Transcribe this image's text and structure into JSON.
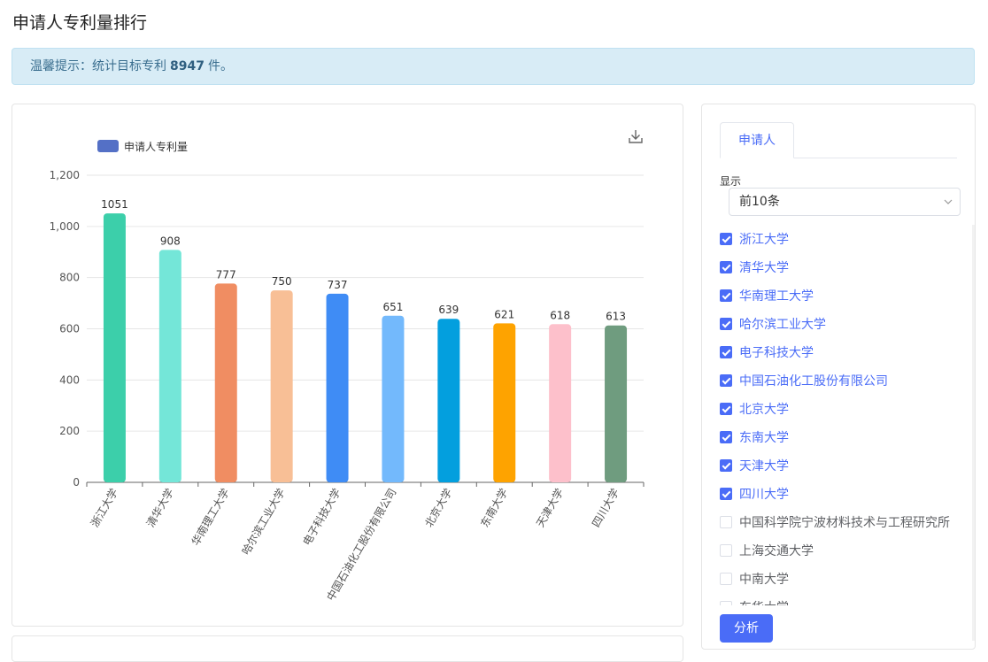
{
  "page_title": "申请人专利量排行",
  "alert": {
    "prefix": "温馨提示：统计目标专利",
    "count": "8947",
    "suffix": "件。"
  },
  "colors": [
    "#3ccfaa",
    "#74e6d8",
    "#f08d62",
    "#f8bf96",
    "#3f8cf5",
    "#73b9fc",
    "#039fde",
    "#fea300",
    "#fdc0cb",
    "#6f9c7f"
  ],
  "chart_data": {
    "type": "bar",
    "legend": "申请人专利量",
    "legend_position": "top-left",
    "categories": [
      "浙江大学",
      "清华大学",
      "华南理工大学",
      "哈尔滨工业大学",
      "电子科技大学",
      "中国石油化工股份有限公司",
      "北京大学",
      "东南大学",
      "天津大学",
      "四川大学"
    ],
    "values": [
      1051,
      908,
      777,
      750,
      737,
      651,
      639,
      621,
      618,
      613
    ],
    "yticks": [
      "0",
      "200",
      "400",
      "600",
      "800",
      "1,000",
      "1,200"
    ],
    "ylim": [
      0,
      1200
    ],
    "grid": true
  },
  "sidebar": {
    "tab": "申请人",
    "show_label": "显示",
    "select_value": "前10条",
    "items": [
      {
        "label": "浙江大学",
        "checked": true
      },
      {
        "label": "清华大学",
        "checked": true
      },
      {
        "label": "华南理工大学",
        "checked": true
      },
      {
        "label": "哈尔滨工业大学",
        "checked": true
      },
      {
        "label": "电子科技大学",
        "checked": true
      },
      {
        "label": "中国石油化工股份有限公司",
        "checked": true
      },
      {
        "label": "北京大学",
        "checked": true
      },
      {
        "label": "东南大学",
        "checked": true
      },
      {
        "label": "天津大学",
        "checked": true
      },
      {
        "label": "四川大学",
        "checked": true
      },
      {
        "label": "中国科学院宁波材料技术与工程研究所",
        "checked": false
      },
      {
        "label": "上海交通大学",
        "checked": false
      },
      {
        "label": "中南大学",
        "checked": false
      },
      {
        "label": "东华大学",
        "checked": false
      }
    ],
    "analyze_label": "分析"
  },
  "icons": {
    "download": "download-icon",
    "select_arrow": "chevron-down-icon"
  }
}
